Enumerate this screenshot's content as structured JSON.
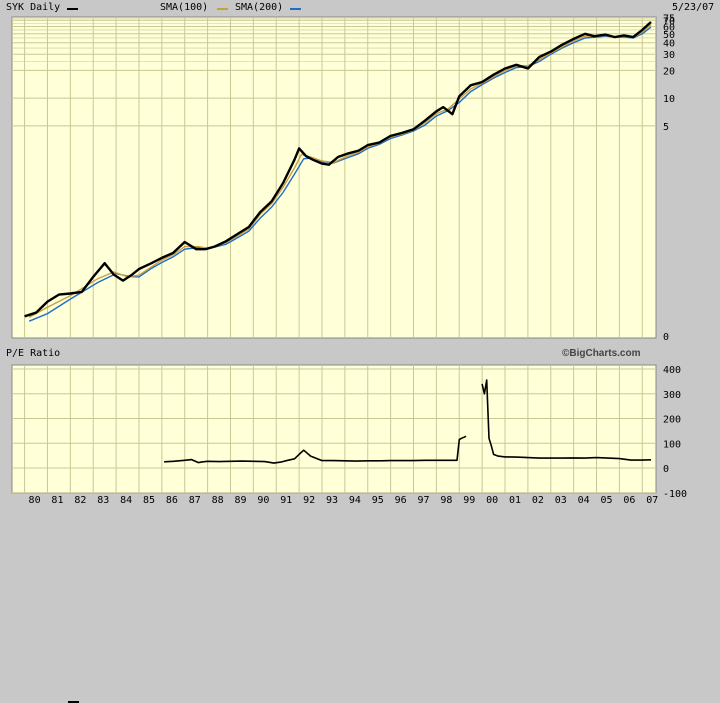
{
  "colors": {
    "background": "#c8c8c8",
    "plot_bg": "#ffffd8",
    "grid": "#c8c896",
    "price": "#000000",
    "sma100": "#c8a040",
    "sma200": "#1e6ec8"
  },
  "header": {
    "ticker_label": "SYK Daily",
    "sma100_label": "SMA(100)",
    "sma200_label": "SMA(200)",
    "date": "5/23/07"
  },
  "pe_header": {
    "label": "P/E Ratio",
    "credit": "©BigCharts.com"
  },
  "chart_data": [
    {
      "type": "line",
      "title": "SYK Daily",
      "scale": "log",
      "x_tick_labels": [
        "80",
        "81",
        "82",
        "83",
        "84",
        "85",
        "86",
        "87",
        "88",
        "89",
        "90",
        "91",
        "92",
        "93",
        "94",
        "95",
        "96",
        "97",
        "98",
        "99",
        "00",
        "01",
        "02",
        "03",
        "04",
        "05",
        "06",
        "07"
      ],
      "y_tick_labels": [
        "75",
        "70",
        "60",
        "50",
        "40",
        "30",
        "20",
        "10",
        "5",
        "0"
      ],
      "grid": true,
      "series": [
        {
          "name": "SYK Daily",
          "x": [
            1980.0,
            1980.5,
            1981.0,
            1981.5,
            1982.0,
            1982.5,
            1983.0,
            1983.5,
            1983.9,
            1984.3,
            1984.7,
            1985.0,
            1985.5,
            1986.0,
            1986.5,
            1987.0,
            1987.5,
            1987.9,
            1988.3,
            1988.8,
            1989.3,
            1989.8,
            1990.3,
            1990.8,
            1991.3,
            1991.8,
            1992.0,
            1992.3,
            1992.6,
            1993.0,
            1993.3,
            1993.7,
            1994.1,
            1994.6,
            1995.0,
            1995.5,
            1996.0,
            1996.5,
            1997.0,
            1997.5,
            1998.0,
            1998.3,
            1998.7,
            1999.0,
            1999.5,
            2000.0,
            2000.5,
            2001.0,
            2001.5,
            2002.0,
            2002.5,
            2003.0,
            2003.5,
            2004.0,
            2004.5,
            2004.9,
            2005.4,
            2005.8,
            2006.2,
            2006.6,
            2007.0,
            2007.38
          ],
          "values": [
            0.043,
            0.047,
            0.062,
            0.074,
            0.076,
            0.079,
            0.115,
            0.162,
            0.122,
            0.105,
            0.122,
            0.14,
            0.16,
            0.185,
            0.21,
            0.275,
            0.23,
            0.23,
            0.245,
            0.28,
            0.335,
            0.4,
            0.58,
            0.76,
            1.2,
            2.15,
            2.85,
            2.35,
            2.15,
            1.95,
            1.9,
            2.3,
            2.5,
            2.7,
            3.1,
            3.3,
            3.9,
            4.2,
            4.6,
            5.7,
            7.2,
            8.0,
            6.7,
            10.5,
            13.8,
            15.0,
            18.0,
            21.0,
            23.0,
            21.0,
            28.0,
            32.0,
            38.0,
            44.0,
            50.0,
            47.0,
            49.0,
            46.0,
            48.0,
            46.0,
            55.0,
            67.0
          ]
        },
        {
          "name": "SMA(100)",
          "x": [
            1980.2,
            1981.0,
            1982.0,
            1983.2,
            1983.9,
            1984.5,
            1985.0,
            1985.5,
            1986.0,
            1986.5,
            1987.0,
            1987.6,
            1988.0,
            1988.8,
            1989.3,
            1989.8,
            1990.3,
            1990.8,
            1991.3,
            1991.8,
            1992.1,
            1992.5,
            1993.0,
            1993.5,
            1994.1,
            1994.6,
            1995.0,
            1995.5,
            1996.0,
            1996.5,
            1997.0,
            1997.5,
            1998.0,
            1998.5,
            1999.0,
            1999.5,
            2000.0,
            2000.5,
            2001.0,
            2001.5,
            2002.0,
            2002.5,
            2003.0,
            2003.5,
            2004.0,
            2004.5,
            2005.0,
            2005.4,
            2005.8,
            2006.2,
            2006.6,
            2007.0,
            2007.38
          ],
          "values": [
            0.042,
            0.054,
            0.072,
            0.11,
            0.13,
            0.115,
            0.12,
            0.145,
            0.175,
            0.2,
            0.245,
            0.245,
            0.235,
            0.27,
            0.32,
            0.38,
            0.55,
            0.72,
            1.08,
            1.75,
            2.45,
            2.3,
            2.08,
            2.0,
            2.35,
            2.6,
            2.95,
            3.25,
            3.8,
            4.1,
            4.5,
            5.4,
            6.8,
            7.6,
            9.8,
            12.6,
            14.5,
            17.0,
            20.0,
            22.5,
            22.5,
            26.0,
            31.0,
            36.0,
            42.0,
            47.0,
            47.0,
            48.0,
            46.0,
            47.0,
            45.5,
            52.0,
            63.0
          ]
        },
        {
          "name": "SMA(200)",
          "x": [
            1980.2,
            1981.0,
            1982.0,
            1983.2,
            1984.0,
            1984.6,
            1985.0,
            1985.5,
            1986.0,
            1986.5,
            1987.0,
            1987.6,
            1988.0,
            1988.8,
            1989.3,
            1989.8,
            1990.3,
            1990.8,
            1991.3,
            1991.8,
            1992.2,
            1992.6,
            1993.0,
            1993.5,
            1994.1,
            1994.6,
            1995.0,
            1995.5,
            1996.0,
            1996.5,
            1997.0,
            1997.5,
            1998.0,
            1998.5,
            1999.0,
            1999.5,
            2000.0,
            2000.5,
            2001.0,
            2001.5,
            2002.0,
            2002.5,
            2003.0,
            2003.5,
            2004.0,
            2004.5,
            2005.0,
            2005.4,
            2005.8,
            2006.2,
            2006.6,
            2007.0,
            2007.38
          ],
          "values": [
            0.038,
            0.046,
            0.066,
            0.1,
            0.125,
            0.116,
            0.115,
            0.14,
            0.165,
            0.19,
            0.23,
            0.24,
            0.232,
            0.26,
            0.305,
            0.36,
            0.5,
            0.66,
            0.95,
            1.5,
            2.2,
            2.25,
            2.05,
            1.98,
            2.25,
            2.5,
            2.85,
            3.15,
            3.65,
            4.0,
            4.4,
            5.1,
            6.4,
            7.3,
            9.0,
            11.8,
            14.0,
            16.5,
            19.0,
            21.5,
            22.0,
            25.0,
            30.0,
            35.0,
            40.0,
            45.0,
            46.0,
            47.0,
            46.0,
            46.0,
            45.0,
            50.0,
            59.0
          ]
        }
      ]
    },
    {
      "type": "line",
      "title": "P/E Ratio",
      "x_tick_labels": [
        "80",
        "81",
        "82",
        "83",
        "84",
        "85",
        "86",
        "87",
        "88",
        "89",
        "90",
        "91",
        "92",
        "93",
        "94",
        "95",
        "96",
        "97",
        "98",
        "99",
        "00",
        "01",
        "02",
        "03",
        "04",
        "05",
        "06",
        "07"
      ],
      "y_tick_labels": [
        "400",
        "300",
        "200",
        "100",
        "0",
        "-100"
      ],
      "ylim": [
        -100,
        400
      ],
      "grid": true,
      "series": [
        {
          "name": "P/E Ratio",
          "x": [
            1986.1,
            1986.5,
            1987.0,
            1987.3,
            1987.6,
            1987.8,
            1988.0,
            1988.5,
            1989.0,
            1989.5,
            1990.0,
            1990.5,
            1990.9,
            1991.2,
            1991.5,
            1991.8,
            1992.0,
            1992.2,
            1992.5,
            1993.0,
            1993.5,
            1994.0,
            1994.5,
            1995.0,
            1995.5,
            1996.0,
            1996.5,
            1997.0,
            1997.5,
            1998.0,
            1998.5,
            1998.9,
            1999.0,
            1999.1,
            1999.3,
            1999.5,
            1999.9,
            2000.0,
            2000.1,
            2000.2,
            2000.3,
            2000.4,
            2000.5,
            2000.7,
            2001.0,
            2001.5,
            2002.0,
            2002.5,
            2003.0,
            2003.5,
            2004.0,
            2004.5,
            2005.0,
            2005.5,
            2006.0,
            2006.5,
            2007.0,
            2007.38
          ],
          "values": [
            25,
            27,
            31,
            34,
            22,
            25,
            27,
            26,
            27,
            28,
            27,
            26,
            20,
            24,
            31,
            37,
            55,
            72,
            48,
            30,
            30,
            29,
            28,
            29,
            29,
            30,
            30,
            30,
            31,
            31,
            31,
            31,
            115,
            120,
            128,
            null,
            null,
            340,
            300,
            355,
            120,
            90,
            55,
            48,
            45,
            44,
            42,
            40,
            40,
            40,
            41,
            40,
            42,
            40,
            38,
            32,
            32,
            33
          ]
        }
      ]
    }
  ]
}
